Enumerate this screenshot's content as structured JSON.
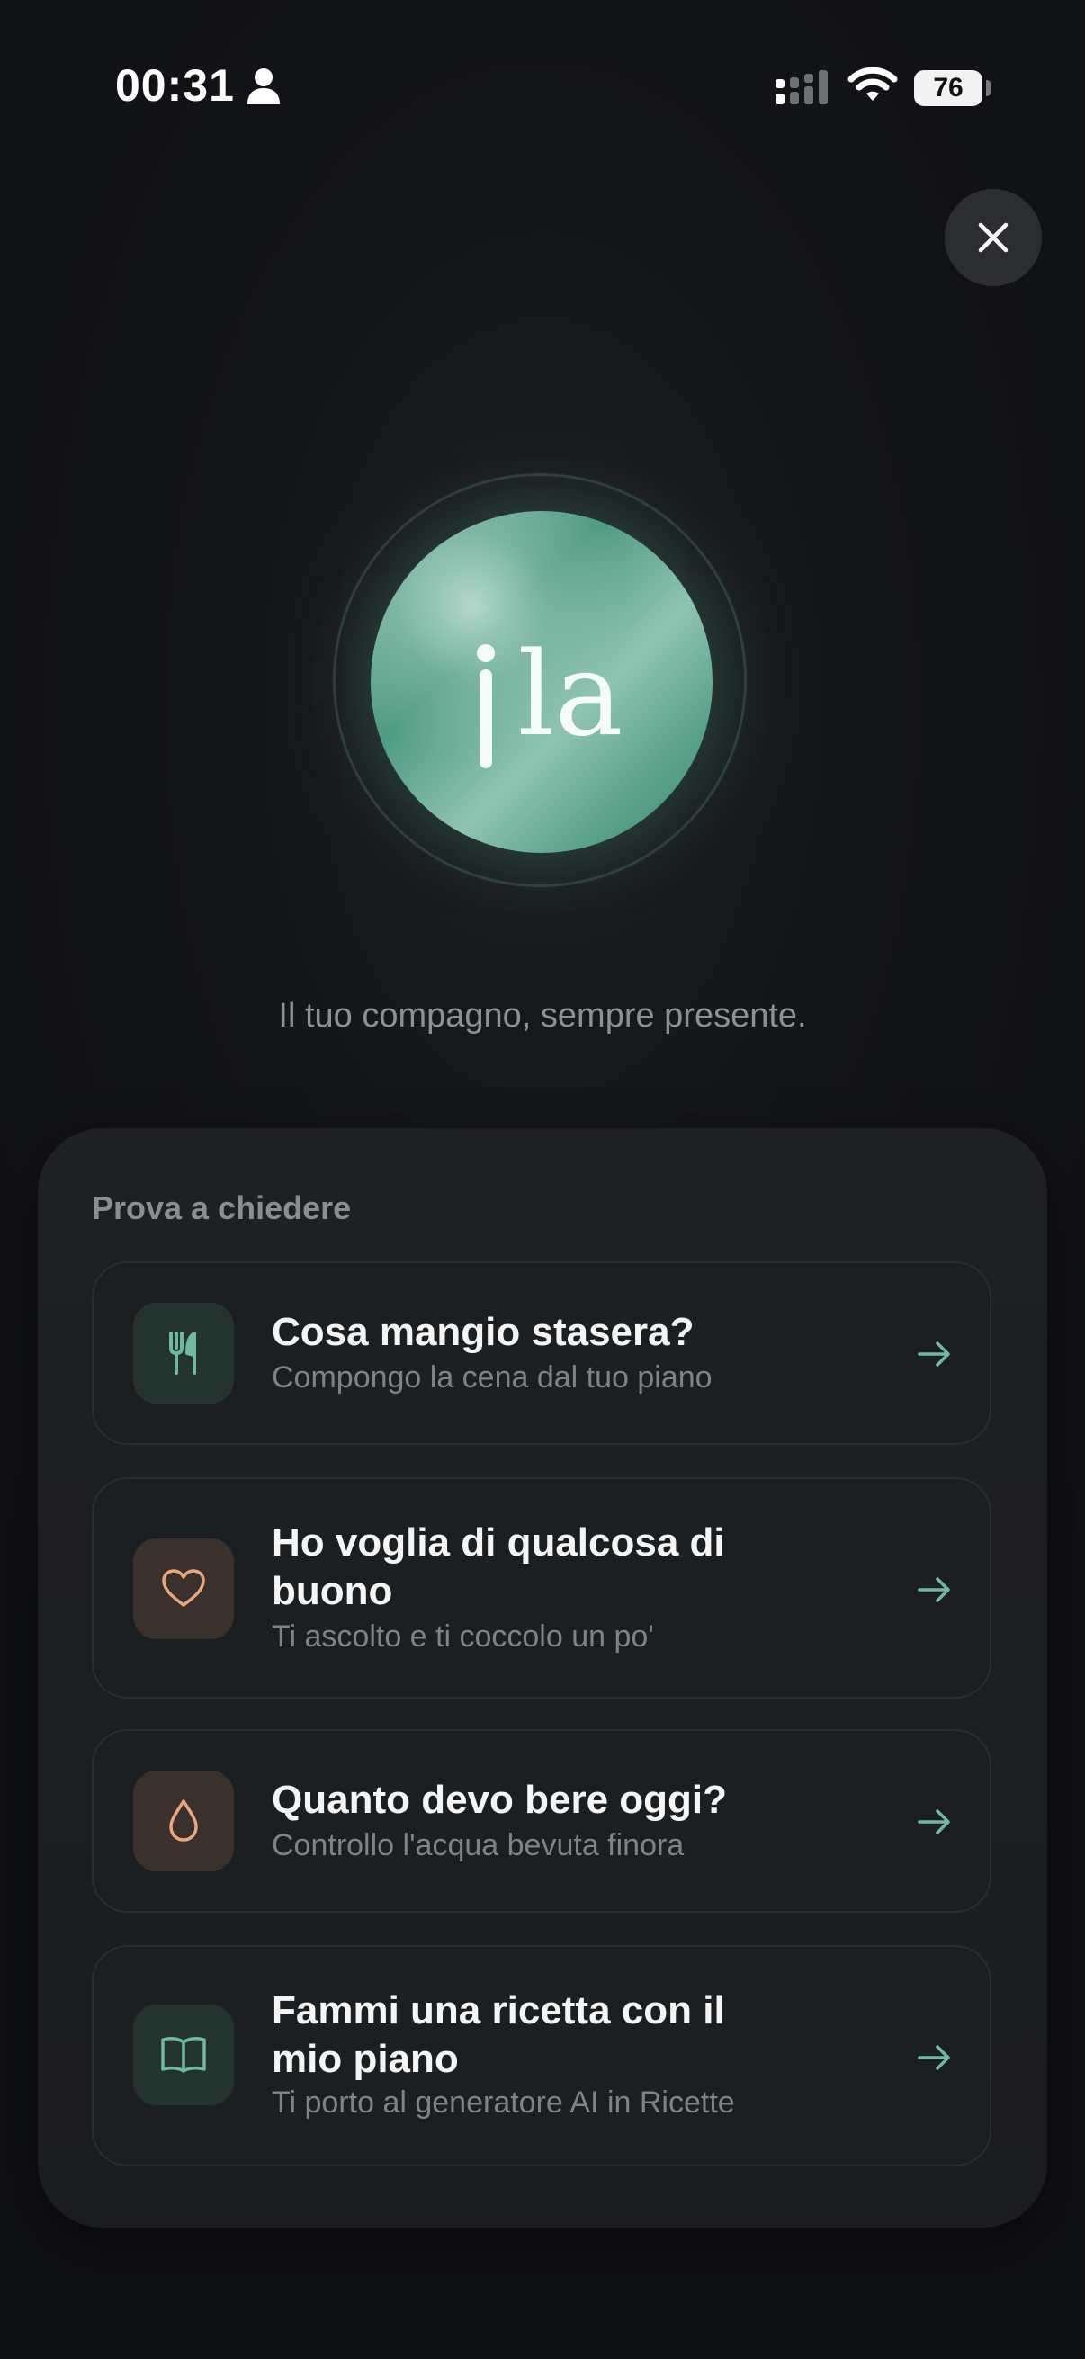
{
  "status_bar": {
    "time": "00:31",
    "battery": "76"
  },
  "hero": {
    "logo_text": "ila",
    "tagline": "Il tuo compagno, sempre presente."
  },
  "suggestions": {
    "title": "Prova a chiedere",
    "items": [
      {
        "title": "Cosa mangio stasera?",
        "subtitle": "Compongo la cena dal tuo piano",
        "icon": "fork-knife-icon"
      },
      {
        "title": "Ho voglia di qualcosa di buono",
        "subtitle": "Ti ascolto e ti coccolo un po'",
        "icon": "heart-icon"
      },
      {
        "title": "Quanto devo bere oggi?",
        "subtitle": "Controllo l'acqua bevuta finora",
        "icon": "water-drop-icon"
      },
      {
        "title": "Fammi una ricetta con il mio piano",
        "subtitle": "Ti porto al generatore AI in Ricette",
        "icon": "open-book-icon"
      }
    ]
  },
  "colors": {
    "accent_green": "#6fb9a0",
    "accent_warm": "#e8a77f",
    "background": "#121316"
  }
}
